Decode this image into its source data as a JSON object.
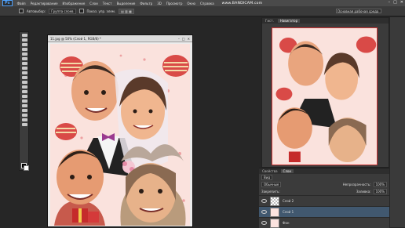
{
  "app": {
    "logo": "Ps",
    "watermark": "www.BANDICAM.com"
  },
  "menu": [
    "Файл",
    "Редактирование",
    "Изображение",
    "Слои",
    "Текст",
    "Выделение",
    "Фильтр",
    "3D",
    "Просмотр",
    "Окно",
    "Справка"
  ],
  "window_controls": {
    "minimize": "–",
    "maximize": "□",
    "close": "✕"
  },
  "options": {
    "autoselect_label": "Автовыбор:",
    "autoselect_value": "Группа слоев",
    "transform_label": "Показ. упр. элем.",
    "workspace": "Основная рабочая среда"
  },
  "document": {
    "tab_title": "11.jpg @ 50% (Слой 1, RGB/8) *"
  },
  "navigator": {
    "tabs": [
      "Гист.",
      "Навигатор"
    ]
  },
  "layers": {
    "tabs": [
      "Свойства",
      "Слои"
    ],
    "kind": "Вид",
    "blend_mode": "Обычные",
    "opacity_label": "Непрозрачность:",
    "opacity_value": "100%",
    "lock_label": "Закрепить:",
    "fill_label": "Заливка:",
    "fill_value": "100%",
    "items": [
      {
        "name": "Слой 2",
        "selected": false
      },
      {
        "name": "Слой 1",
        "selected": true
      },
      {
        "name": "Фон",
        "selected": false
      }
    ]
  },
  "icons": {
    "eye": "eye-icon"
  },
  "colors": {
    "accent": "#4ea2ff",
    "selected_layer": "#41586f",
    "selection_frame": "#cc3333"
  }
}
